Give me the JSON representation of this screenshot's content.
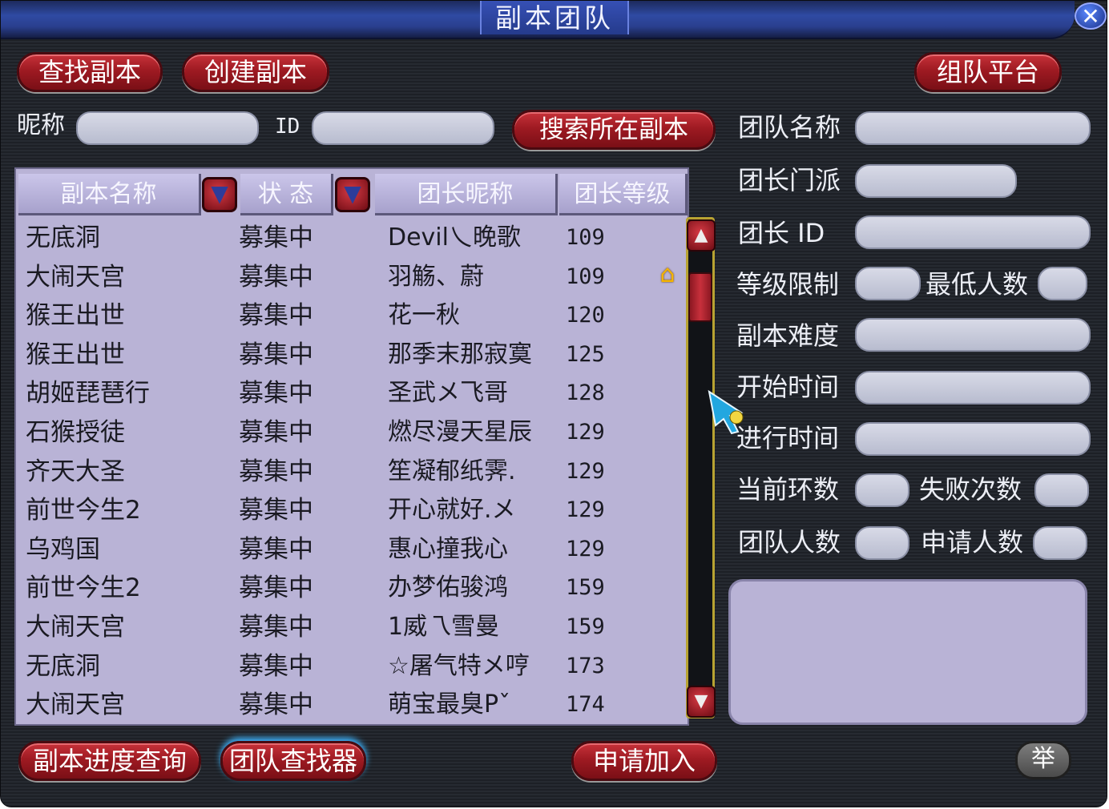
{
  "window": {
    "title": "副本团队",
    "close_label": "✕"
  },
  "top_buttons": {
    "find": "查找副本",
    "create": "创建副本",
    "platform": "组队平台"
  },
  "search": {
    "nickname_label": "昵称",
    "id_label": "ID",
    "search_button": "搜索所在副本"
  },
  "table": {
    "headers": [
      "副本名称",
      "状 态",
      "团长昵称",
      "团长等级"
    ],
    "rows": [
      {
        "name": "无底洞",
        "status": "募集中",
        "leader": "Devil乀晚歌",
        "level": "109"
      },
      {
        "name": "大闹天宫",
        "status": "募集中",
        "leader": "羽觞、蔚",
        "level": "109"
      },
      {
        "name": "猴王出世",
        "status": "募集中",
        "leader": "花一秋",
        "level": "120"
      },
      {
        "name": "猴王出世",
        "status": "募集中",
        "leader": "那季末那寂寞",
        "level": "125"
      },
      {
        "name": "胡姬琵琶行",
        "status": "募集中",
        "leader": "圣武メ飞哥",
        "level": "128"
      },
      {
        "name": "石猴授徒",
        "status": "募集中",
        "leader": "燃尽漫天星辰",
        "level": "129"
      },
      {
        "name": "齐天大圣",
        "status": "募集中",
        "leader": "笙凝郁纸霁.",
        "level": "129"
      },
      {
        "name": "前世今生2",
        "status": "募集中",
        "leader": "开心就好.メ",
        "level": "129"
      },
      {
        "name": "乌鸡国",
        "status": "募集中",
        "leader": "惠心撞我心",
        "level": "129"
      },
      {
        "name": "前世今生2",
        "status": "募集中",
        "leader": "办梦佑骏鸿",
        "level": "159"
      },
      {
        "name": "大闹天宫",
        "status": "募集中",
        "leader": "1威乁雪曼",
        "level": "159"
      },
      {
        "name": "无底洞",
        "status": "募集中",
        "leader": "☆屠气特メ哼",
        "level": "173"
      },
      {
        "name": "大闹天宫",
        "status": "募集中",
        "leader": "萌宝最臭Pˇ",
        "level": "174"
      }
    ]
  },
  "details": {
    "team_name": "团队名称",
    "leader_school": "团长门派",
    "leader_id": "团长 ID",
    "level_limit": "等级限制",
    "min_people": "最低人数",
    "difficulty": "副本难度",
    "start_time": "开始时间",
    "elapsed_time": "进行时间",
    "current_round": "当前环数",
    "fail_count": "失败次数",
    "team_size": "团队人数",
    "apply_count": "申请人数"
  },
  "bottom_buttons": {
    "progress": "副本进度查询",
    "finder": "团队查找器",
    "apply": "申请加入",
    "report": "举"
  }
}
